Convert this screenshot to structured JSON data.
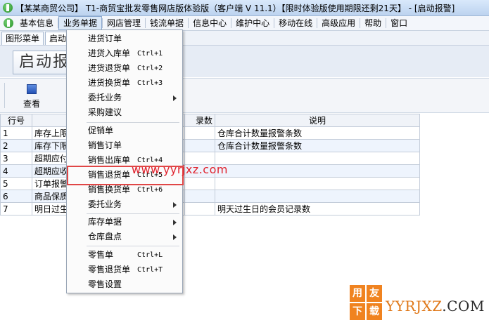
{
  "title_bar": {
    "text": "【某某商贸公司】 T1-商贸宝批发零售网店版体验版（客户端 V 11.1）【限时体验版使用期限还剩21天】 - [启动报警]"
  },
  "menubar": {
    "items": [
      "基本信息",
      "业务单据",
      "网店管理",
      "钱流单据",
      "信息中心",
      "维护中心",
      "移动在线",
      "高级应用",
      "帮助",
      "窗口"
    ],
    "active": "业务单据"
  },
  "tabs": [
    "图形菜单",
    "启动"
  ],
  "page_title": "启动报",
  "toolbar": {
    "view_label": "查看"
  },
  "grid": {
    "headers": [
      "行号",
      "",
      "录数",
      "说明"
    ],
    "rows": [
      {
        "num": "1",
        "name": "库存上限",
        "desc": "仓库合计数量报警条数"
      },
      {
        "num": "2",
        "name": "库存下限",
        "desc": "仓库合计数量报警条数"
      },
      {
        "num": "3",
        "name": "超期应付",
        "desc": ""
      },
      {
        "num": "4",
        "name": "超期应收",
        "desc": ""
      },
      {
        "num": "5",
        "name": "订单报警",
        "desc": ""
      },
      {
        "num": "6",
        "name": "商品保质",
        "desc": ""
      },
      {
        "num": "7",
        "name": "明日过生",
        "desc": "明天过生日的会员记录数"
      }
    ]
  },
  "dropdown": {
    "items": [
      {
        "label": "进货订单",
        "shortcut": "",
        "submenu": false
      },
      {
        "label": "进货入库单",
        "shortcut": "Ctrl+1",
        "submenu": false
      },
      {
        "label": "进货退货单",
        "shortcut": "Ctrl+2",
        "submenu": false
      },
      {
        "label": "进货换货单",
        "shortcut": "Ctrl+3",
        "submenu": false
      },
      {
        "label": "委托业务",
        "shortcut": "",
        "submenu": true
      },
      {
        "label": "采购建议",
        "shortcut": "",
        "submenu": false
      },
      {
        "label": "促销单",
        "shortcut": "",
        "submenu": false
      },
      {
        "label": "销售订单",
        "shortcut": "",
        "submenu": false
      },
      {
        "label": "销售出库单",
        "shortcut": "Ctrl+4",
        "submenu": false
      },
      {
        "label": "销售退货单",
        "shortcut": "Ctrl+5",
        "submenu": false
      },
      {
        "label": "销售换货单",
        "shortcut": "Ctrl+6",
        "submenu": false
      },
      {
        "label": "委托业务",
        "shortcut": "",
        "submenu": true
      },
      {
        "label": "库存单据",
        "shortcut": "",
        "submenu": true
      },
      {
        "label": "仓库盘点",
        "shortcut": "",
        "submenu": true
      },
      {
        "label": "零售单",
        "shortcut": "Ctrl+L",
        "submenu": false
      },
      {
        "label": "零售退货单",
        "shortcut": "Ctrl+T",
        "submenu": false
      },
      {
        "label": "零售设置",
        "shortcut": "",
        "submenu": false
      }
    ],
    "highlighted": "销售退货单"
  },
  "watermark": {
    "url": "www.yyrjxz.com",
    "logo_chars": [
      "用",
      "友",
      "下",
      "载"
    ],
    "domain_part1": "YYRJXZ",
    "domain_part2": ".COM"
  },
  "colors": {
    "highlight_border": "#e04646",
    "watermark_red": "#e0212c",
    "logo_orange": "#f08320"
  }
}
